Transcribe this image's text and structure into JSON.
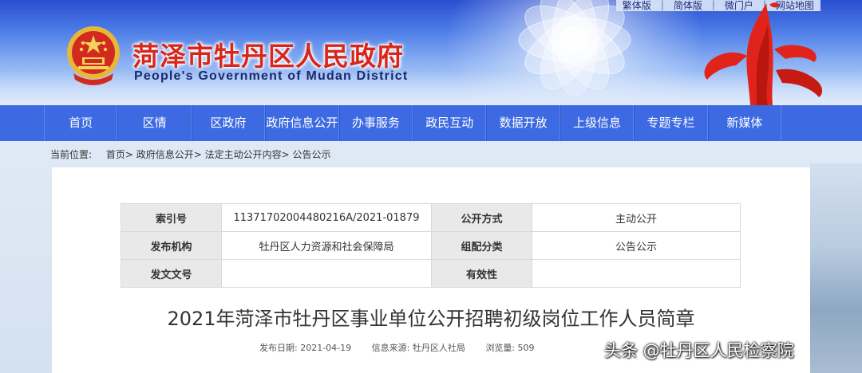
{
  "header": {
    "title": "菏泽市牡丹区人民政府",
    "subtitle": "People's Government of Mudan District",
    "top_links": [
      "繁体版",
      "简体版",
      "微门户",
      "网站地图"
    ]
  },
  "nav": {
    "items": [
      "首页",
      "区情",
      "区政府",
      "政府信息公开",
      "办事服务",
      "政民互动",
      "数据开放",
      "上级信息",
      "专题专栏",
      "新媒体"
    ]
  },
  "breadcrumb": {
    "lead": "当前位置:",
    "path": "首页> 政府信息公开> 法定主动公开内容> 公告公示"
  },
  "meta": {
    "index_label": "索引号",
    "index_value": "11371702004480216A/2021-01879",
    "method_label": "公开方式",
    "method_value": "主动公开",
    "org_label": "发布机构",
    "org_value": "牡丹区人力资源和社会保障局",
    "category_label": "组配分类",
    "category_value": "公告公示",
    "doc_no_label": "发文文号",
    "doc_no_value": "",
    "validity_label": "有效性",
    "validity_value": ""
  },
  "article": {
    "title": "2021年菏泽市牡丹区事业单位公开招聘初级岗位工作人员简章",
    "date": "发布日期: 2021-04-19",
    "source": "信息来源: 牡丹区人社局",
    "views": "浏览量:  509"
  },
  "watermark": "头条 @牡丹区人民检察院",
  "colors": {
    "nav_bg": "#3d6ae2",
    "title_red": "#d8261c",
    "subtitle_navy": "#1a2a6a"
  },
  "icons": {
    "emblem": "national-emblem-icon",
    "sculpture": "red-sculpture-image"
  }
}
